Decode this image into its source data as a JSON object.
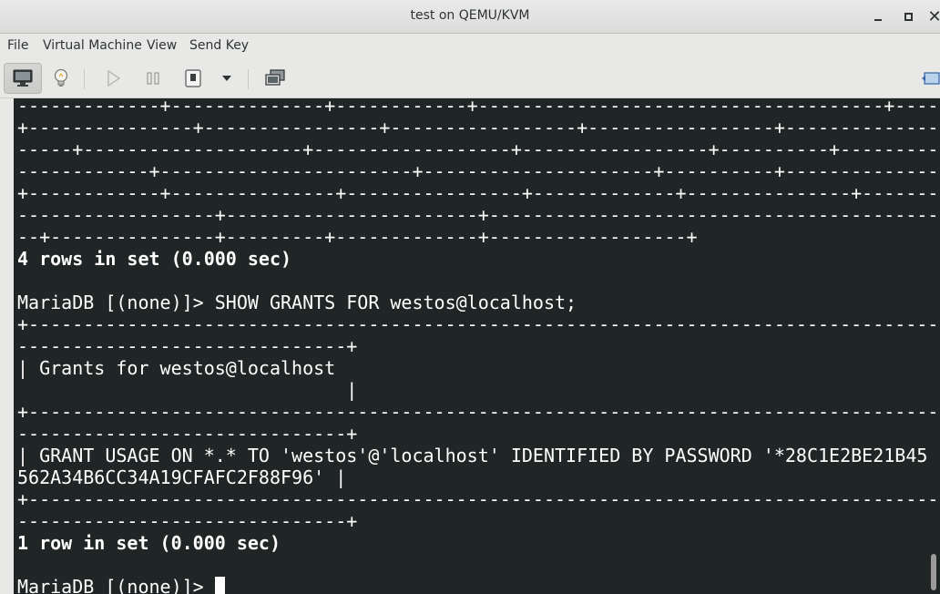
{
  "window": {
    "title": "test on QEMU/KVM"
  },
  "menubar": {
    "items": [
      "File",
      "Virtual Machine",
      "View",
      "Send Key"
    ]
  },
  "toolbar": {
    "icons": [
      "monitor-icon",
      "lightbulb-icon",
      "play-icon",
      "pause-icon",
      "power-icon",
      "chevron-down-icon",
      "snapshot-icon",
      "fullscreen-icon"
    ]
  },
  "console": {
    "lines": [
      {
        "text": "-------------+--------------+------------+-------------------------------------+-------------------------",
        "bold": false
      },
      {
        "text": "+---------------+----------------+-----------------+-----------------+----------------------------",
        "bold": false
      },
      {
        "text": "-----+--------------------+------------------+-----------------+----------+-------------------------------",
        "bold": false
      },
      {
        "text": "------------+-----------------------+---------------------+----------+-----------------------------",
        "bold": false
      },
      {
        "text": "+------------+---------------+----------------+-------------+---------------+------------------------",
        "bold": false
      },
      {
        "text": "------------------+-----------------------+---------------------------------------------------------",
        "bold": false
      },
      {
        "text": "--+---------------+---------+-------------+------------------+",
        "bold": false
      },
      {
        "text": "4 rows in set (0.000 sec)",
        "bold": true
      },
      {
        "text": "",
        "bold": false
      },
      {
        "text": "MariaDB [(none)]> SHOW GRANTS FOR westos@localhost;",
        "bold": false
      },
      {
        "text": "+-------------------------------------------------------------------------------------",
        "bold": false
      },
      {
        "text": "------------------------------+",
        "bold": false
      },
      {
        "text": "| Grants for westos@localhost",
        "bold": false
      },
      {
        "text": "                              |",
        "bold": false
      },
      {
        "text": "+-------------------------------------------------------------------------------------",
        "bold": false
      },
      {
        "text": "------------------------------+",
        "bold": false
      },
      {
        "text": "| GRANT USAGE ON *.* TO 'westos'@'localhost' IDENTIFIED BY PASSWORD '*28C1E2BE21B45",
        "bold": false
      },
      {
        "text": "562A34B6CC34A19CFAFC2F88F96' |",
        "bold": false
      },
      {
        "text": "+-------------------------------------------------------------------------------------",
        "bold": false
      },
      {
        "text": "------------------------------+",
        "bold": false
      },
      {
        "text": "1 row in set (0.000 sec)",
        "bold": true
      },
      {
        "text": "",
        "bold": false
      },
      {
        "text": "MariaDB [(none)]> ",
        "bold": false
      }
    ]
  },
  "colors": {
    "console_bg": "#202526",
    "console_fg": "#ffffff",
    "chrome_bg": "#e8e8e7"
  }
}
